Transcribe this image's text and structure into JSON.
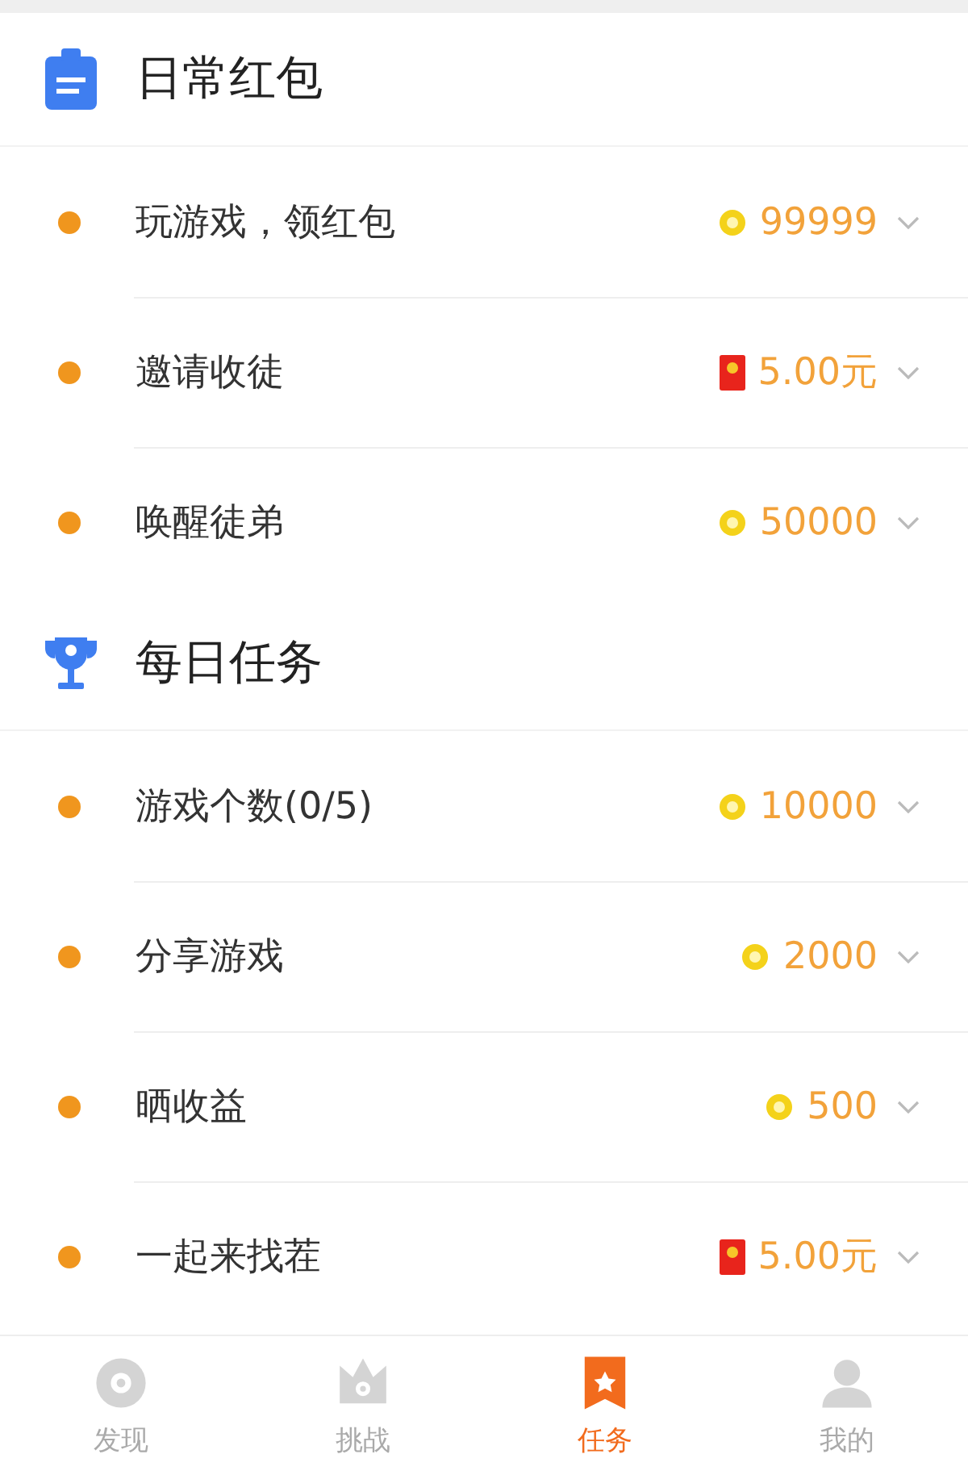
{
  "sections": [
    {
      "title": "日常红包",
      "tasks": [
        {
          "name": "玩游戏，领红包",
          "reward": {
            "kind": "coin",
            "amount": "99999"
          }
        },
        {
          "name": "邀请收徒",
          "reward": {
            "kind": "redpacket",
            "amount": "5.00元"
          }
        },
        {
          "name": "唤醒徒弟",
          "reward": {
            "kind": "coin",
            "amount": "50000"
          }
        }
      ]
    },
    {
      "title": "每日任务",
      "tasks": [
        {
          "name": "游戏个数(0/5)",
          "reward": {
            "kind": "coin",
            "amount": "10000"
          }
        },
        {
          "name": "分享游戏",
          "reward": {
            "kind": "coin",
            "amount": "2000"
          }
        },
        {
          "name": "晒收益",
          "reward": {
            "kind": "coin",
            "amount": "500"
          }
        },
        {
          "name": "一起来找茬",
          "reward": {
            "kind": "redpacket",
            "amount": "5.00元"
          }
        }
      ]
    }
  ],
  "tabs": [
    {
      "label": "发现",
      "selected": false
    },
    {
      "label": "挑战",
      "selected": false
    },
    {
      "label": "任务",
      "selected": true
    },
    {
      "label": "我的",
      "selected": false
    }
  ]
}
